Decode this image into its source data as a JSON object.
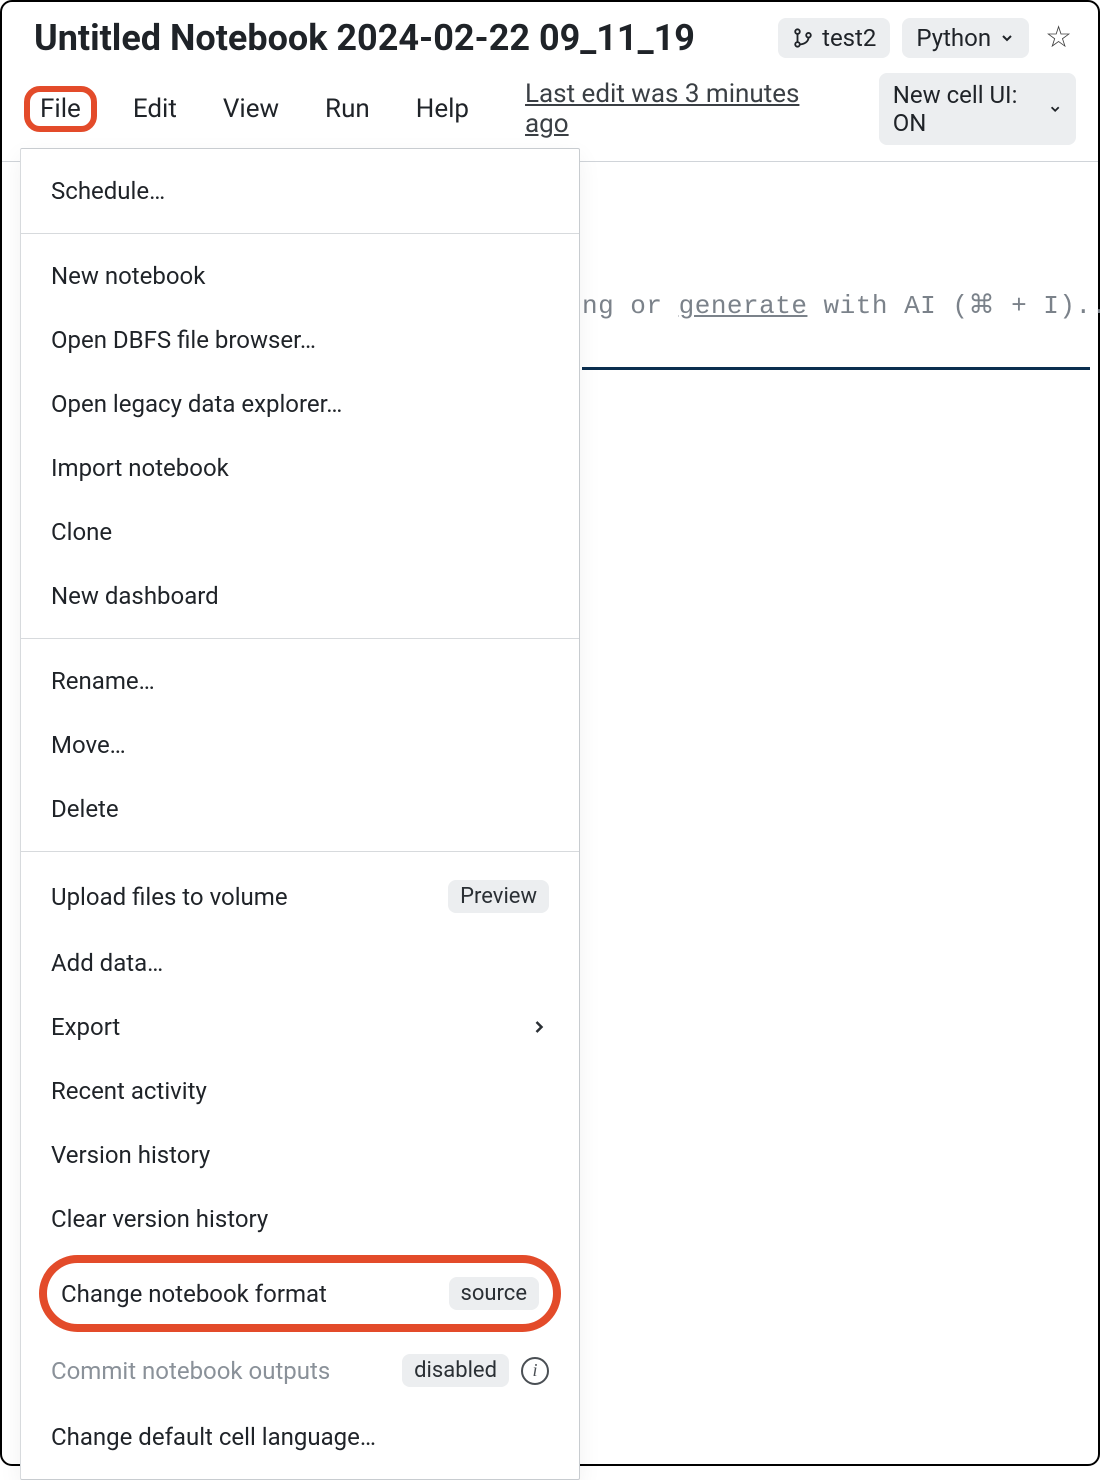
{
  "header": {
    "title": "Untitled Notebook 2024-02-22 09_11_19",
    "compute_label": "test2",
    "language_label": "Python"
  },
  "menubar": {
    "file": "File",
    "edit": "Edit",
    "view": "View",
    "run": "Run",
    "help": "Help",
    "last_edit": "Last edit was 3 minutes ago",
    "newcell_label": "New cell UI: ON"
  },
  "editor": {
    "hint_mid": "ng or ",
    "hint_generate": "generate",
    "hint_tail": " with AI (⌘ + I)..."
  },
  "file_menu": {
    "schedule": "Schedule…",
    "new_notebook": "New notebook",
    "open_dbfs": "Open DBFS file browser…",
    "open_legacy": "Open legacy data explorer…",
    "import_notebook": "Import notebook",
    "clone": "Clone",
    "new_dashboard": "New dashboard",
    "rename": "Rename…",
    "move": "Move…",
    "delete": "Delete",
    "upload_volume": "Upload files to volume",
    "upload_volume_badge": "Preview",
    "add_data": "Add data…",
    "export": "Export",
    "recent_activity": "Recent activity",
    "version_history": "Version history",
    "clear_version_history": "Clear version history",
    "change_format": "Change notebook format",
    "change_format_badge": "source",
    "commit_outputs": "Commit notebook outputs",
    "commit_outputs_badge": "disabled",
    "change_default_lang": "Change default cell language…"
  }
}
